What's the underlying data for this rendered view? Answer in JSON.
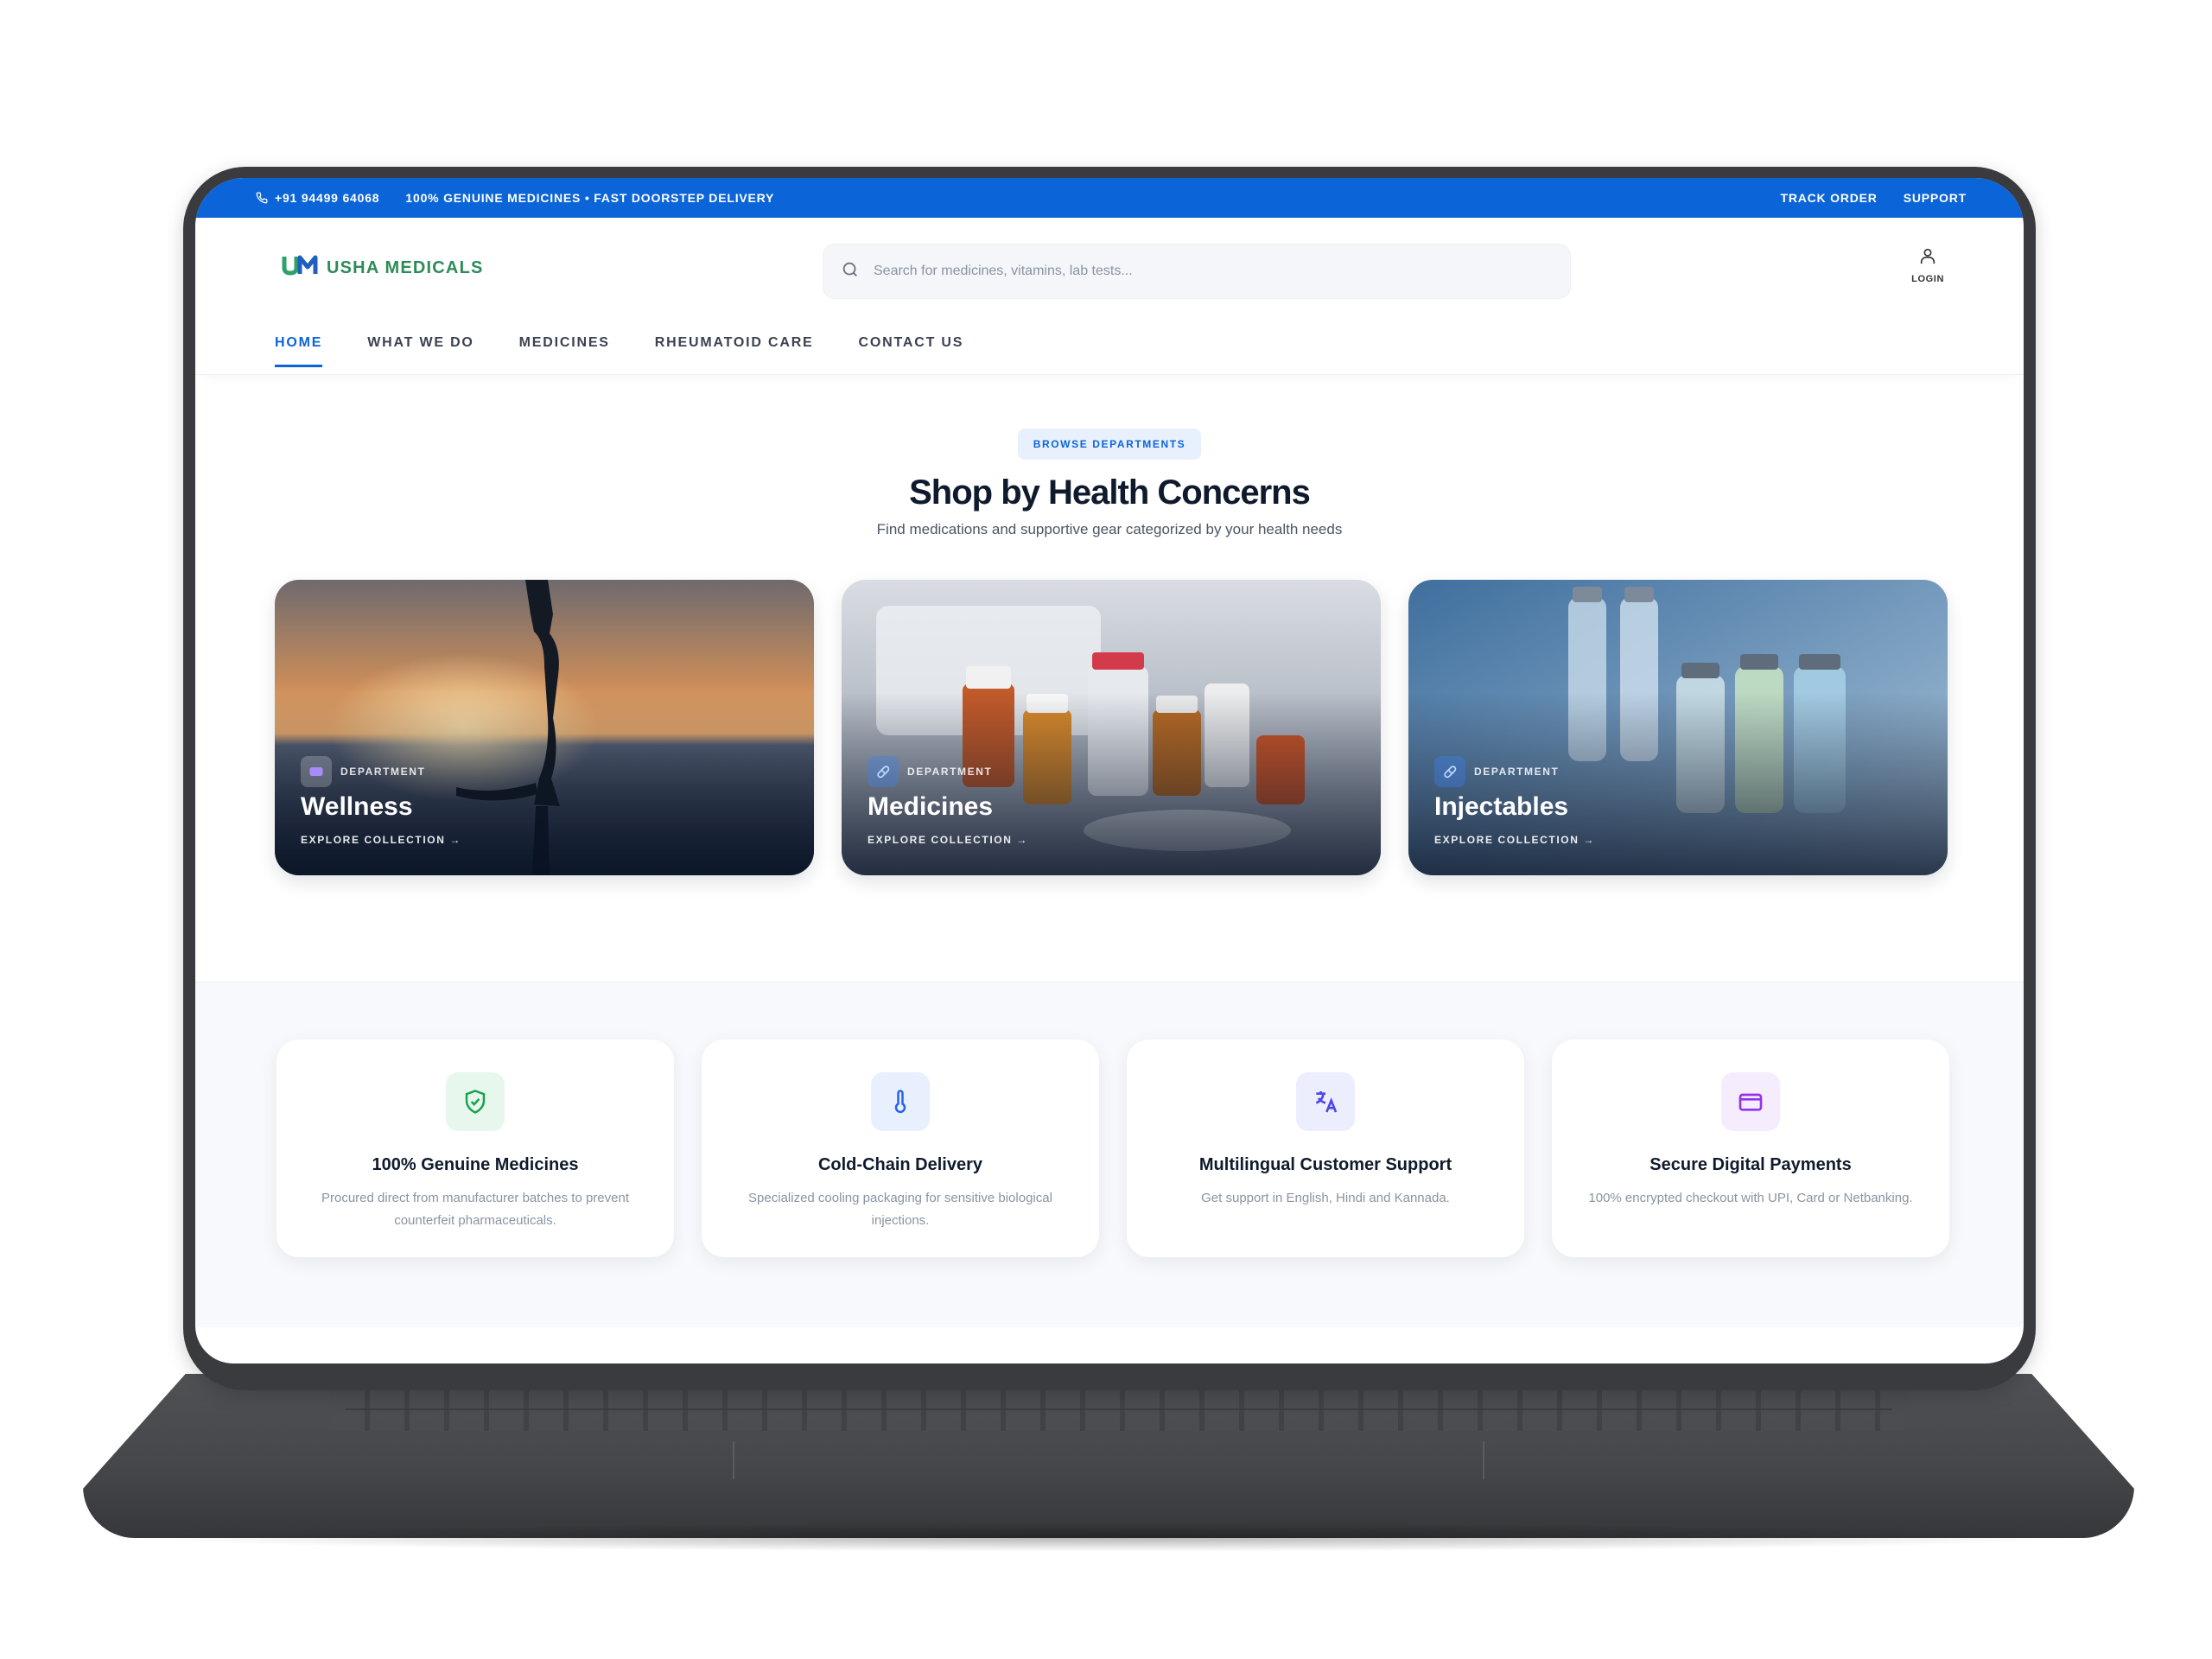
{
  "topbar": {
    "phone": "+91 94499 64068",
    "tagline": "100% GENUINE MEDICINES • FAST DOORSTEP DELIVERY",
    "track_order": "TRACK ORDER",
    "support": "SUPPORT"
  },
  "header": {
    "logo_mark": "UM",
    "logo_text": "USHA MEDICALS",
    "search_placeholder": "Search for medicines, vitamins, lab tests...",
    "login_label": "LOGIN"
  },
  "nav": {
    "items": [
      {
        "label": "HOME",
        "active": true
      },
      {
        "label": "WHAT WE DO"
      },
      {
        "label": "MEDICINES"
      },
      {
        "label": "RHEUMATOID CARE"
      },
      {
        "label": "CONTACT US"
      }
    ]
  },
  "departments": {
    "eyebrow": "BROWSE DEPARTMENTS",
    "title": "Shop by Health Concerns",
    "subtitle": "Find medications and supportive gear categorized by your health needs",
    "cards": [
      {
        "label": "DEPARTMENT",
        "title": "Wellness",
        "cta": "EXPLORE COLLECTION →",
        "icon": "heart-icon",
        "accent": "#8b5cf6"
      },
      {
        "label": "DEPARTMENT",
        "title": "Medicines",
        "cta": "EXPLORE COLLECTION →",
        "icon": "pill-icon",
        "accent": "#3b82f6"
      },
      {
        "label": "DEPARTMENT",
        "title": "Injectables",
        "cta": "EXPLORE COLLECTION →",
        "icon": "pill-icon",
        "accent": "#3b82f6"
      }
    ]
  },
  "features": [
    {
      "icon": "shield-check-icon",
      "title": "100% Genuine Medicines",
      "desc": "Procured direct from manufacturer batches to prevent counterfeit pharmaceuticals.",
      "color": "#16a34a"
    },
    {
      "icon": "thermometer-icon",
      "title": "Cold-Chain Delivery",
      "desc": "Specialized cooling packaging for sensitive biological injections.",
      "color": "#2563eb"
    },
    {
      "icon": "translate-icon",
      "title": "Multilingual Customer Support",
      "desc": "Get support in English, Hindi and Kannada.",
      "color": "#4f46e5"
    },
    {
      "icon": "credit-card-icon",
      "title": "Secure Digital Payments",
      "desc": "100% encrypted checkout with UPI, Card or Netbanking.",
      "color": "#9333ea"
    }
  ],
  "colors": {
    "brand_blue": "#0b64d8",
    "brand_green": "#2e8b57",
    "laptop_body": "#3a3b3f"
  }
}
